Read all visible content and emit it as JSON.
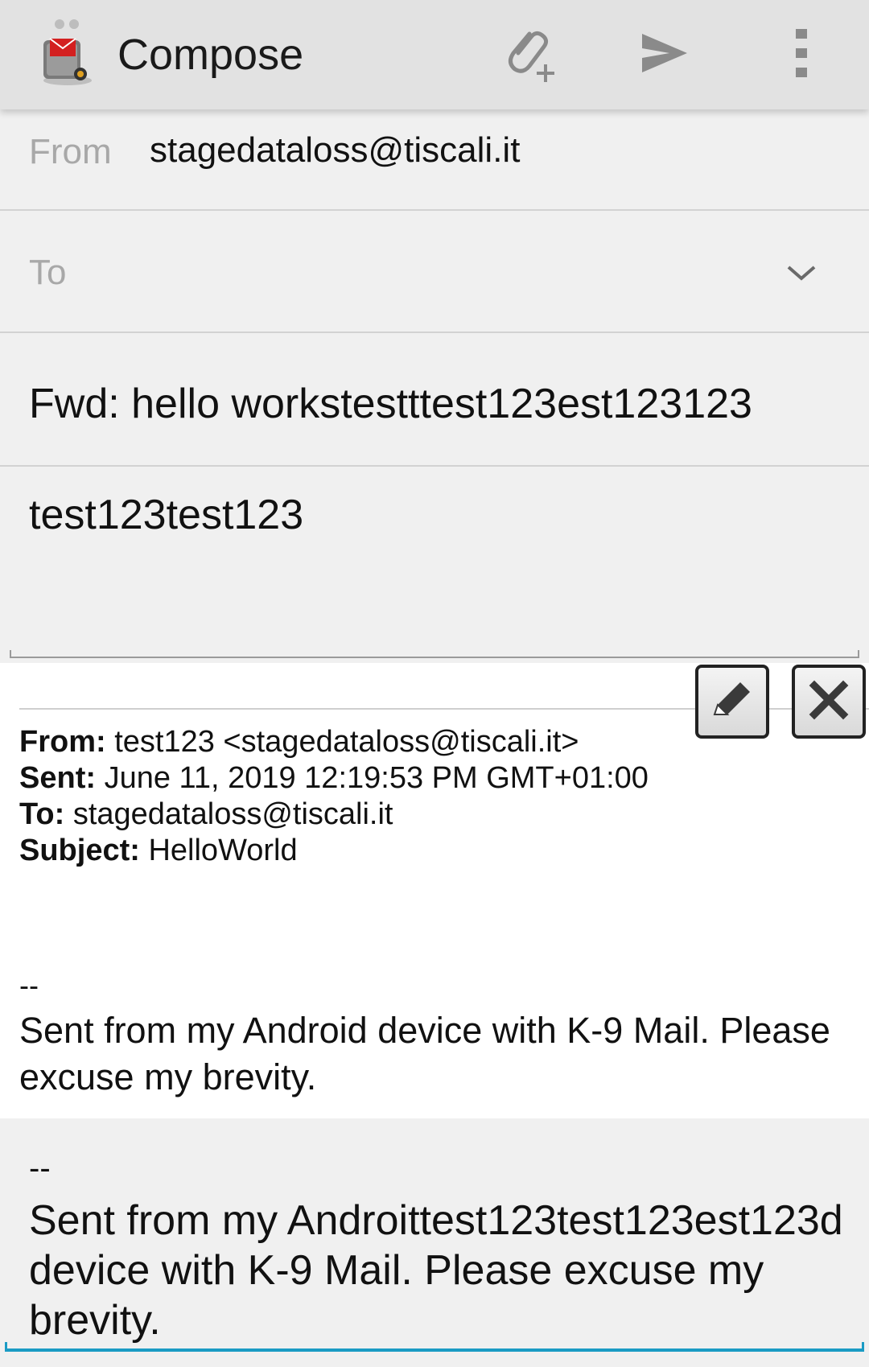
{
  "action_bar": {
    "title": "Compose",
    "logo_icon": "k9-mail-logo-icon",
    "attach_icon": "attach-file-plus-icon",
    "send_icon": "send-icon",
    "overflow_icon": "more-vert-icon"
  },
  "header": {
    "from_label": "From",
    "from_value": "stagedataloss@tiscali.it",
    "to_label": "To",
    "to_placeholder": "To",
    "subject_value": "Fwd: hello workstestttest123est123123"
  },
  "body": {
    "text": "test123test123"
  },
  "quoted": {
    "from_label": "From:",
    "from_value": "test123 <stagedataloss@tiscali.it>",
    "sent_label": "Sent:",
    "sent_value": "June 11, 2019 12:19:53 PM GMT+01:00",
    "to_label": "To:",
    "to_value": "stagedataloss@tiscali.it",
    "subject_label": "Subject:",
    "subject_value": "HelloWorld",
    "sig_dash": "--",
    "sig_text": "Sent from my Android device with K-9 Mail. Please excuse my brevity.",
    "edit_icon": "pencil-icon",
    "delete_icon": "close-icon"
  },
  "signature": {
    "dash": "--",
    "text": "Sent from my Androittest123test123est123d device with K-9 Mail. Please excuse my brevity."
  },
  "colors": {
    "action_bar": "#e2e2e2",
    "background": "#f0f0f0",
    "label_gray": "#a8a8a8",
    "focus_accent": "#1a9bc4"
  }
}
